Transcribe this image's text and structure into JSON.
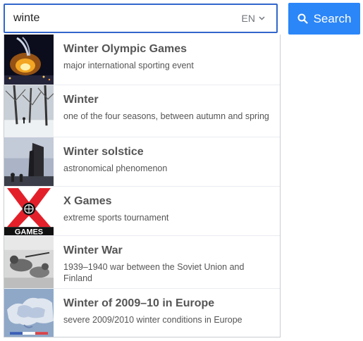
{
  "search": {
    "query": "winte",
    "language": "EN",
    "button_label": "Search"
  },
  "suggestions": [
    {
      "title": "Winter Olympic Games",
      "description": "major international sporting event"
    },
    {
      "title": "Winter",
      "description": "one of the four seasons, between autumn and spring"
    },
    {
      "title": "Winter solstice",
      "description": "astronomical phenomenon"
    },
    {
      "title": "X Games",
      "description": "extreme sports tournament"
    },
    {
      "title": "Winter War",
      "description": "1939–1940 war between the Soviet Union and Finland"
    },
    {
      "title": "Winter of 2009–10 in Europe",
      "description": "severe 2009/2010 winter conditions in Europe"
    }
  ],
  "thumbnail_text": {
    "x_games_logo": "GAMES"
  },
  "colors": {
    "accent": "#2b86f8",
    "input_border": "#3366cc",
    "text": "#555555",
    "muted": "#72777d"
  }
}
